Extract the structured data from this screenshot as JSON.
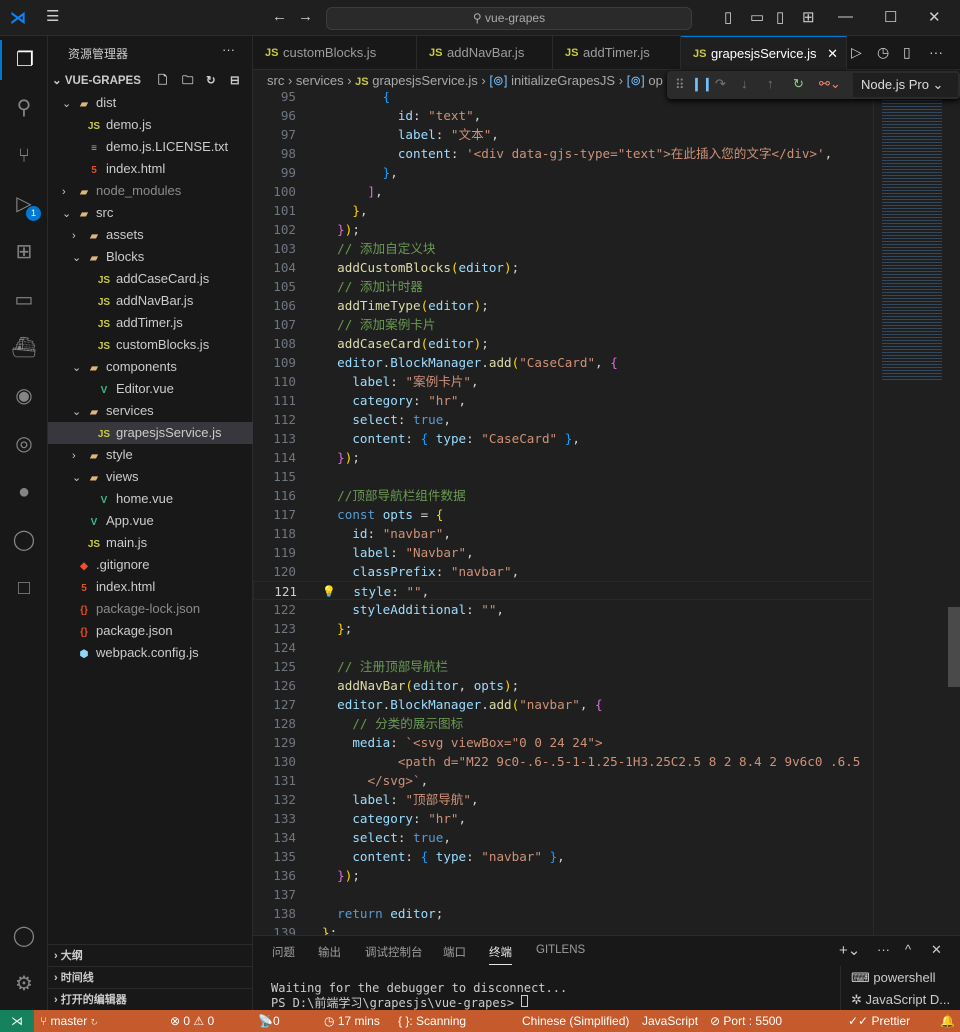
{
  "title": {
    "search": "vue-grapes"
  },
  "sidebar": {
    "header": "资源管理器",
    "root": "VUE-GRAPES",
    "items": [
      {
        "label": "dist",
        "depth": 1,
        "type": "folder",
        "open": true,
        "color": "#e2c08d"
      },
      {
        "label": "demo.js",
        "depth": 2,
        "type": "js"
      },
      {
        "label": "demo.js.LICENSE.txt",
        "depth": 2,
        "type": "txt"
      },
      {
        "label": "index.html",
        "depth": 2,
        "type": "html"
      },
      {
        "label": "node_modules",
        "depth": 1,
        "type": "folder",
        "open": false,
        "dim": true
      },
      {
        "label": "src",
        "depth": 1,
        "type": "folder",
        "open": true
      },
      {
        "label": "assets",
        "depth": 2,
        "type": "folder",
        "open": false
      },
      {
        "label": "Blocks",
        "depth": 2,
        "type": "folder",
        "open": true
      },
      {
        "label": "addCaseCard.js",
        "depth": 3,
        "type": "js"
      },
      {
        "label": "addNavBar.js",
        "depth": 3,
        "type": "js"
      },
      {
        "label": "addTimer.js",
        "depth": 3,
        "type": "js"
      },
      {
        "label": "customBlocks.js",
        "depth": 3,
        "type": "js"
      },
      {
        "label": "components",
        "depth": 2,
        "type": "folder",
        "open": true
      },
      {
        "label": "Editor.vue",
        "depth": 3,
        "type": "vue"
      },
      {
        "label": "services",
        "depth": 2,
        "type": "folder",
        "open": true
      },
      {
        "label": "grapesjsService.js",
        "depth": 3,
        "type": "js",
        "selected": true
      },
      {
        "label": "style",
        "depth": 2,
        "type": "folder",
        "open": false
      },
      {
        "label": "views",
        "depth": 2,
        "type": "folder",
        "open": true
      },
      {
        "label": "home.vue",
        "depth": 3,
        "type": "vue"
      },
      {
        "label": "App.vue",
        "depth": 2,
        "type": "vue"
      },
      {
        "label": "main.js",
        "depth": 2,
        "type": "js"
      },
      {
        "label": ".gitignore",
        "depth": 1,
        "type": "git"
      },
      {
        "label": "index.html",
        "depth": 1,
        "type": "html"
      },
      {
        "label": "package-lock.json",
        "depth": 1,
        "type": "json",
        "dim": true
      },
      {
        "label": "package.json",
        "depth": 1,
        "type": "json"
      },
      {
        "label": "webpack.config.js",
        "depth": 1,
        "type": "cfg"
      }
    ],
    "sections": [
      "大纲",
      "时间线",
      "打开的编辑器"
    ]
  },
  "tabs": [
    {
      "label": "customBlocks.js"
    },
    {
      "label": "addNavBar.js"
    },
    {
      "label": "addTimer.js"
    },
    {
      "label": "grapesjsService.js",
      "active": true
    }
  ],
  "breadcrumb": [
    "src",
    "services",
    "grapesjsService.js",
    "initializeGrapesJS",
    "op"
  ],
  "debug": {
    "config": "Node.js Pro"
  },
  "activity": {
    "debug_badge": "1"
  },
  "editor": {
    "current_line": 121,
    "lines": [
      [
        95,
        [
          [
            "t",
            "        "
          ],
          [
            "bb",
            "{"
          ]
        ]
      ],
      [
        96,
        [
          [
            "t",
            "          "
          ],
          [
            "p",
            "id"
          ],
          [
            "t",
            ": "
          ],
          [
            "s",
            "\"text\""
          ],
          [
            "t",
            ","
          ]
        ]
      ],
      [
        97,
        [
          [
            "t",
            "          "
          ],
          [
            "p",
            "label"
          ],
          [
            "t",
            ": "
          ],
          [
            "s",
            "\"文本\""
          ],
          [
            "t",
            ","
          ]
        ]
      ],
      [
        98,
        [
          [
            "t",
            "          "
          ],
          [
            "p",
            "content"
          ],
          [
            "t",
            ": "
          ],
          [
            "s",
            "'<div data-gjs-type=\"text\">在此插入您的文字</div>'"
          ],
          [
            "t",
            ","
          ]
        ]
      ],
      [
        99,
        [
          [
            "t",
            "        "
          ],
          [
            "bb",
            "}"
          ],
          [
            "t",
            ","
          ]
        ]
      ],
      [
        100,
        [
          [
            "t",
            "      "
          ],
          [
            "m",
            "]"
          ],
          [
            "t",
            ","
          ]
        ]
      ],
      [
        101,
        [
          [
            "t",
            "    "
          ],
          [
            "y",
            "}"
          ],
          [
            "t",
            ","
          ]
        ]
      ],
      [
        102,
        [
          [
            "t",
            "  "
          ],
          [
            "m",
            "}"
          ],
          [
            "y",
            ")"
          ],
          [
            "t",
            ";"
          ]
        ]
      ],
      [
        103,
        [
          [
            "t",
            "  "
          ],
          [
            "c",
            "// 添加自定义块"
          ]
        ]
      ],
      [
        104,
        [
          [
            "t",
            "  "
          ],
          [
            "f",
            "addCustomBlocks"
          ],
          [
            "y",
            "("
          ],
          [
            "p",
            "editor"
          ],
          [
            "y",
            ")"
          ],
          [
            "t",
            ";"
          ]
        ]
      ],
      [
        105,
        [
          [
            "t",
            "  "
          ],
          [
            "c",
            "// 添加计时器"
          ]
        ]
      ],
      [
        106,
        [
          [
            "t",
            "  "
          ],
          [
            "f",
            "addTimeType"
          ],
          [
            "y",
            "("
          ],
          [
            "p",
            "editor"
          ],
          [
            "y",
            ")"
          ],
          [
            "t",
            ";"
          ]
        ]
      ],
      [
        107,
        [
          [
            "t",
            "  "
          ],
          [
            "c",
            "// 添加案例卡片"
          ]
        ]
      ],
      [
        108,
        [
          [
            "t",
            "  "
          ],
          [
            "f",
            "addCaseCard"
          ],
          [
            "y",
            "("
          ],
          [
            "p",
            "editor"
          ],
          [
            "y",
            ")"
          ],
          [
            "t",
            ";"
          ]
        ]
      ],
      [
        109,
        [
          [
            "t",
            "  "
          ],
          [
            "p",
            "editor"
          ],
          [
            "t",
            "."
          ],
          [
            "p",
            "BlockManager"
          ],
          [
            "t",
            "."
          ],
          [
            "f",
            "add"
          ],
          [
            "y",
            "("
          ],
          [
            "s",
            "\"CaseCard\""
          ],
          [
            "t",
            ", "
          ],
          [
            "m",
            "{"
          ]
        ]
      ],
      [
        110,
        [
          [
            "t",
            "    "
          ],
          [
            "p",
            "label"
          ],
          [
            "t",
            ": "
          ],
          [
            "s",
            "\"案例卡片\""
          ],
          [
            "t",
            ","
          ]
        ]
      ],
      [
        111,
        [
          [
            "t",
            "    "
          ],
          [
            "p",
            "category"
          ],
          [
            "t",
            ": "
          ],
          [
            "s",
            "\"hr\""
          ],
          [
            "t",
            ","
          ]
        ]
      ],
      [
        112,
        [
          [
            "t",
            "    "
          ],
          [
            "p",
            "select"
          ],
          [
            "t",
            ": "
          ],
          [
            "k",
            "true"
          ],
          [
            "t",
            ","
          ]
        ]
      ],
      [
        113,
        [
          [
            "t",
            "    "
          ],
          [
            "p",
            "content"
          ],
          [
            "t",
            ": "
          ],
          [
            "bb",
            "{"
          ],
          [
            "t",
            " "
          ],
          [
            "p",
            "type"
          ],
          [
            "t",
            ": "
          ],
          [
            "s",
            "\"CaseCard\""
          ],
          [
            "t",
            " "
          ],
          [
            "bb",
            "}"
          ],
          [
            "t",
            ","
          ]
        ]
      ],
      [
        114,
        [
          [
            "t",
            "  "
          ],
          [
            "m",
            "}"
          ],
          [
            "y",
            ")"
          ],
          [
            "t",
            ";"
          ]
        ]
      ],
      [
        115,
        []
      ],
      [
        116,
        [
          [
            "t",
            "  "
          ],
          [
            "c",
            "//顶部导航栏组件数据"
          ]
        ]
      ],
      [
        117,
        [
          [
            "t",
            "  "
          ],
          [
            "k",
            "const"
          ],
          [
            "t",
            " "
          ],
          [
            "p",
            "opts"
          ],
          [
            "t",
            " = "
          ],
          [
            "y",
            "{"
          ]
        ]
      ],
      [
        118,
        [
          [
            "t",
            "    "
          ],
          [
            "p",
            "id"
          ],
          [
            "t",
            ": "
          ],
          [
            "s",
            "\"navbar\""
          ],
          [
            "t",
            ","
          ]
        ]
      ],
      [
        119,
        [
          [
            "t",
            "    "
          ],
          [
            "p",
            "label"
          ],
          [
            "t",
            ": "
          ],
          [
            "s",
            "\"Navbar\""
          ],
          [
            "t",
            ","
          ]
        ]
      ],
      [
        120,
        [
          [
            "t",
            "    "
          ],
          [
            "p",
            "classPrefix"
          ],
          [
            "t",
            ": "
          ],
          [
            "s",
            "\"navbar\""
          ],
          [
            "t",
            ","
          ]
        ]
      ],
      [
        121,
        [
          [
            "t",
            "    "
          ],
          [
            "p",
            "style"
          ],
          [
            "t",
            ": "
          ],
          [
            "s",
            "\"\""
          ],
          [
            "t",
            ","
          ]
        ]
      ],
      [
        122,
        [
          [
            "t",
            "    "
          ],
          [
            "p",
            "styleAdditional"
          ],
          [
            "t",
            ": "
          ],
          [
            "s",
            "\"\""
          ],
          [
            "t",
            ","
          ]
        ]
      ],
      [
        123,
        [
          [
            "t",
            "  "
          ],
          [
            "y",
            "}"
          ],
          [
            "t",
            ";"
          ]
        ]
      ],
      [
        124,
        []
      ],
      [
        125,
        [
          [
            "t",
            "  "
          ],
          [
            "c",
            "// 注册顶部导航栏"
          ]
        ]
      ],
      [
        126,
        [
          [
            "t",
            "  "
          ],
          [
            "f",
            "addNavBar"
          ],
          [
            "y",
            "("
          ],
          [
            "p",
            "editor"
          ],
          [
            "t",
            ", "
          ],
          [
            "p",
            "opts"
          ],
          [
            "y",
            ")"
          ],
          [
            "t",
            ";"
          ]
        ]
      ],
      [
        127,
        [
          [
            "t",
            "  "
          ],
          [
            "p",
            "editor"
          ],
          [
            "t",
            "."
          ],
          [
            "p",
            "BlockManager"
          ],
          [
            "t",
            "."
          ],
          [
            "f",
            "add"
          ],
          [
            "y",
            "("
          ],
          [
            "s",
            "\"navbar\""
          ],
          [
            "t",
            ", "
          ],
          [
            "m",
            "{"
          ]
        ]
      ],
      [
        128,
        [
          [
            "t",
            "    "
          ],
          [
            "c",
            "// 分类的展示图标"
          ]
        ]
      ],
      [
        129,
        [
          [
            "t",
            "    "
          ],
          [
            "p",
            "media"
          ],
          [
            "t",
            ": "
          ],
          [
            "s",
            "`<svg viewBox=\"0 0 24 24\">"
          ]
        ]
      ],
      [
        130,
        [
          [
            "t",
            "          "
          ],
          [
            "s",
            "<path d=\"M22 9c0-.6-.5-1-1.25-1H3.25C2.5 8 2 8.4 2 9v6c0 .6.5"
          ]
        ]
      ],
      [
        131,
        [
          [
            "t",
            "      "
          ],
          [
            "s",
            "</svg>`"
          ],
          [
            "t",
            ","
          ]
        ]
      ],
      [
        132,
        [
          [
            "t",
            "    "
          ],
          [
            "p",
            "label"
          ],
          [
            "t",
            ": "
          ],
          [
            "s",
            "\"顶部导航\""
          ],
          [
            "t",
            ","
          ]
        ]
      ],
      [
        133,
        [
          [
            "t",
            "    "
          ],
          [
            "p",
            "category"
          ],
          [
            "t",
            ": "
          ],
          [
            "s",
            "\"hr\""
          ],
          [
            "t",
            ","
          ]
        ]
      ],
      [
        134,
        [
          [
            "t",
            "    "
          ],
          [
            "p",
            "select"
          ],
          [
            "t",
            ": "
          ],
          [
            "k",
            "true"
          ],
          [
            "t",
            ","
          ]
        ]
      ],
      [
        135,
        [
          [
            "t",
            "    "
          ],
          [
            "p",
            "content"
          ],
          [
            "t",
            ": "
          ],
          [
            "bb",
            "{"
          ],
          [
            "t",
            " "
          ],
          [
            "p",
            "type"
          ],
          [
            "t",
            ": "
          ],
          [
            "s",
            "\"navbar\""
          ],
          [
            "t",
            " "
          ],
          [
            "bb",
            "}"
          ],
          [
            "t",
            ","
          ]
        ]
      ],
      [
        136,
        [
          [
            "t",
            "  "
          ],
          [
            "m",
            "}"
          ],
          [
            "y",
            ")"
          ],
          [
            "t",
            ";"
          ]
        ]
      ],
      [
        137,
        []
      ],
      [
        138,
        [
          [
            "t",
            "  "
          ],
          [
            "k",
            "return"
          ],
          [
            "t",
            " "
          ],
          [
            "p",
            "editor"
          ],
          [
            "t",
            ";"
          ]
        ]
      ],
      [
        139,
        [
          [
            "y",
            "}"
          ],
          [
            "t",
            ";"
          ]
        ]
      ]
    ]
  },
  "panel": {
    "tabs": [
      "问题",
      "输出",
      "调试控制台",
      "端口",
      "终端",
      "GITLENS"
    ],
    "active": "终端",
    "terminal": [
      "Waiting for the debugger to disconnect...",
      "PS D:\\前端学习\\grapesjs\\vue-grapes> "
    ],
    "sessions": [
      "powershell",
      "JavaScript D..."
    ]
  },
  "status": {
    "items": [
      "master",
      "0",
      "0",
      "0",
      "17 mins",
      "{ }: Scanning",
      "Chinese (Simplified)",
      "JavaScript",
      "Port : 5500",
      "Prettier"
    ]
  },
  "colors": {
    "status_bg": "#c55a2c",
    "accent": "#0078d4"
  }
}
